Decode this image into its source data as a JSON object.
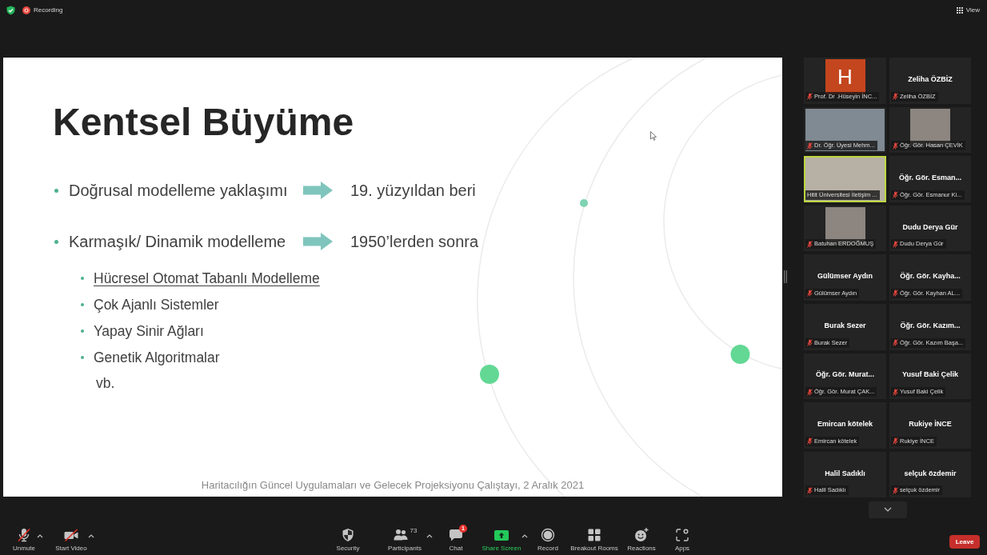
{
  "top_bar": {
    "recording_label": "Recording",
    "view_label": "View"
  },
  "slide": {
    "title": "Kentsel Büyüme",
    "items": [
      {
        "text": "Doğrusal modelleme yaklaşımı",
        "result": "19. yüzyıldan beri"
      },
      {
        "text": "Karmaşık/ Dinamik modelleme",
        "result": "1950’lerden sonra",
        "children": [
          {
            "text": "Hücresel Otomat Tabanlı Modelleme",
            "underlined": true
          },
          {
            "text": "Çok Ajanlı Sistemler",
            "underlined": false
          },
          {
            "text": "Yapay Sinir Ağları",
            "underlined": false
          },
          {
            "text": "Genetik Algoritmalar",
            "underlined": false
          }
        ]
      }
    ],
    "note": "vb.",
    "footer": "Haritacılığın Güncel Uygulamaları ve Gelecek Projeksiyonu Çalıştayı, 2 Aralık 2021"
  },
  "gallery": {
    "rows": [
      [
        {
          "kind": "avatar",
          "initial": "H",
          "color": "#c4461f",
          "label": "Prof. Dr .Hüseyin İNC...",
          "muted": true,
          "active": false
        },
        {
          "kind": "name",
          "title": "Zeliha ÖZBİZ",
          "label": "Zeliha ÖZBİZ",
          "muted": true,
          "active": false
        }
      ],
      [
        {
          "kind": "video",
          "label": "Dr. Öğr. Üyesi Mehm...",
          "muted": true,
          "active": false
        },
        {
          "kind": "photo",
          "label": "Öğr. Gör. Hasan ÇEVİK",
          "muted": true,
          "active": false
        }
      ],
      [
        {
          "kind": "video",
          "label": "Hitit Üniversitesi İletişim ...",
          "muted": false,
          "active": true
        },
        {
          "kind": "name",
          "title": "Öğr. Gör. Esman...",
          "label": "Öğr. Gör. Esmanur Ki...",
          "muted": true,
          "active": false
        }
      ],
      [
        {
          "kind": "photo",
          "label": "Batuhan ERDOĞMUŞ",
          "muted": true,
          "active": false
        },
        {
          "kind": "name",
          "title": "Dudu Derya Gür",
          "label": "Dudu Derya Gür",
          "muted": true,
          "active": false
        }
      ],
      [
        {
          "kind": "name",
          "title": "Gülümser Aydın",
          "label": "Gülümser Aydın",
          "muted": true,
          "active": false
        },
        {
          "kind": "name",
          "title": "Öğr. Gör. Kayha...",
          "label": "Öğr. Gör. Kayhan AL...",
          "muted": true,
          "active": false
        }
      ],
      [
        {
          "kind": "name",
          "title": "Burak Sezer",
          "label": "Burak Sezer",
          "muted": true,
          "active": false
        },
        {
          "kind": "name",
          "title": "Öğr. Gör. Kazım...",
          "label": "Öğr. Gör. Kazım Başa...",
          "muted": true,
          "active": false
        }
      ],
      [
        {
          "kind": "name",
          "title": "Öğr. Gör. Murat...",
          "label": "Öğr. Gör. Murat ÇAK...",
          "muted": true,
          "active": false
        },
        {
          "kind": "name",
          "title": "Yusuf Baki Çelik",
          "label": "Yusuf Baki Çelik",
          "muted": true,
          "active": false
        }
      ],
      [
        {
          "kind": "name",
          "title": "Emircan kötelek",
          "label": "Emircan kötelek",
          "muted": true,
          "active": false
        },
        {
          "kind": "name",
          "title": "Rukiye İNCE",
          "label": "Rukiye İNCE",
          "muted": true,
          "active": false
        }
      ],
      [
        {
          "kind": "name",
          "title": "Halil Sadıklı",
          "label": "Halil Sadıklı",
          "muted": true,
          "active": false
        },
        {
          "kind": "name",
          "title": "selçuk özdemir",
          "label": "selçuk özdemir",
          "muted": true,
          "active": false
        }
      ]
    ]
  },
  "toolbar": {
    "unmute": {
      "label": "Unmute",
      "muted": true
    },
    "start_video": {
      "label": "Start Video",
      "video_off": true
    },
    "security": {
      "label": "Security"
    },
    "participants": {
      "label": "Participants",
      "count": "73"
    },
    "chat": {
      "label": "Chat",
      "badge": "1"
    },
    "share_screen": {
      "label": "Share Screen"
    },
    "record": {
      "label": "Record"
    },
    "breakout_rooms": {
      "label": "Breakout Rooms"
    },
    "reactions": {
      "label": "Reactions"
    },
    "apps": {
      "label": "Apps"
    },
    "leave": {
      "label": "Leave"
    }
  }
}
